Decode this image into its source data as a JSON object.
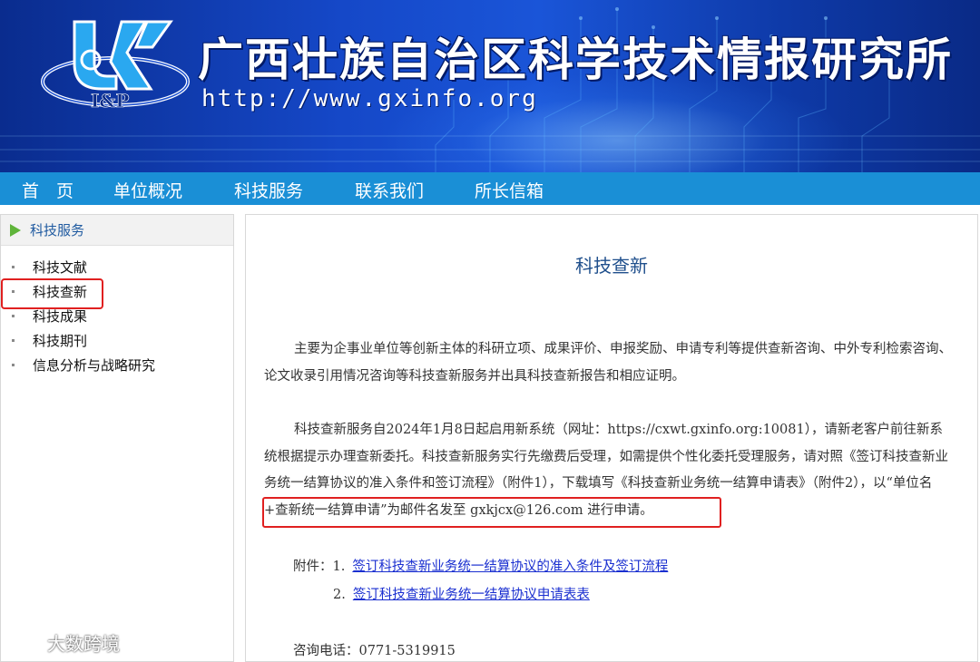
{
  "banner": {
    "title": "广西壮族自治区科学技术情报研究所",
    "url": "http://www.gxinfo.org",
    "logo_text": "I&P"
  },
  "nav": {
    "items": [
      "首　页",
      "单位概况",
      "科技服务",
      "联系我们",
      "所长信箱"
    ]
  },
  "sidebar": {
    "heading": "科技服务",
    "items": [
      "科技文献",
      "科技查新",
      "科技成果",
      "科技期刊",
      "信息分析与战略研究"
    ],
    "selected": "科技查新"
  },
  "content": {
    "title": "科技查新",
    "paragraph1": "主要为企事业单位等创新主体的科研立项、成果评价、申报奖励、申请专利等提供查新咨询、中外专利检索咨询、论文收录引用情况咨询等科技查新服务并出具科技查新报告和相应证明。",
    "paragraph2": "科技查新服务自2024年1月8日起启用新系统（网址：https://cxwt.gxinfo.org:10081），请新老客户前往新系统根据提示办理查新委托。科技查新服务实行先缴费后受理，如需提供个性化委托受理服务，请对照《签订科技查新业务统一结算协议的准入条件和签订流程》（附件1），下载填写《科技查新业务统一结算申请表》（附件2），以“单位名+查新统一结算申请”为邮件名发至 gxkjcx@126.com 进行申请。",
    "attachments_label": "附件：",
    "attachments": [
      {
        "num": "1.",
        "text": "签订科技查新业务统一结算协议的准入条件及签订流程"
      },
      {
        "num": "2.",
        "text": "签订科技查新业务统一结算协议申请表表"
      }
    ],
    "contact": "咨询电话：0771-5319915"
  },
  "watermark": {
    "text": "大数跨境"
  },
  "colors": {
    "nav_bg": "#1a8fd6",
    "title_blue": "#1f4f8c",
    "highlight_red": "#e02020",
    "link_blue": "#1a2fd0",
    "sidebar_arrow": "#5fb43a"
  }
}
